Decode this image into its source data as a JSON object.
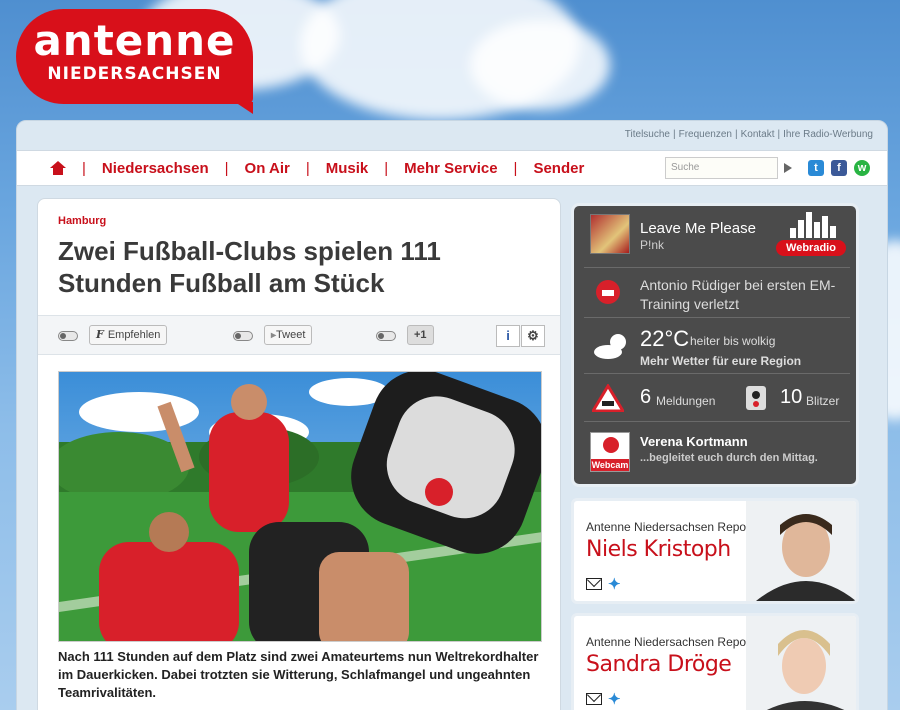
{
  "logo": {
    "main": "antenne",
    "sub": "NIEDERSACHSEN"
  },
  "toplinks": [
    "Titelsuche",
    "Frequenzen",
    "Kontakt",
    "Ihre Radio-Werbung"
  ],
  "nav": {
    "items": [
      "Niedersachsen",
      "On Air",
      "Musik",
      "Mehr Service",
      "Sender"
    ],
    "search_placeholder": "Suche",
    "social": {
      "twitter": "t",
      "facebook": "f",
      "whatsapp": "w"
    }
  },
  "article": {
    "region": "Hamburg",
    "headline": "Zwei Fußball-Clubs spielen 111 Stunden Fußball am Stück",
    "share": {
      "facebook": "Empfehlen",
      "twitter": "Tweet",
      "gplus": "+1",
      "info": "i",
      "settings": "⚙"
    },
    "teaser": "Nach 111 Stunden auf dem Platz sind zwei Amateurtems nun Weltrekordhalter im Dauerkicken. Dabei trotzten sie Witterung, Schlafmangel und ungeahnten Teamrivalitäten."
  },
  "sidebar": {
    "now_playing": {
      "title": "Leave Me  Please",
      "artist": "P!nk",
      "badge": "Webradio"
    },
    "news": "Antonio Rüdiger bei ersten EM-Training verletzt",
    "weather": {
      "temp": "22°C",
      "desc": "heiter bis wolkig",
      "link": "Mehr Wetter für eure Region"
    },
    "traffic": {
      "reports_count": "6",
      "reports_label": "Meldungen",
      "speed_count": "10",
      "speed_label": "Blitzer"
    },
    "webcam": {
      "name": "Verena Kortmann",
      "desc": "...begleitet euch durch den Mittag.",
      "badge": "Webcam"
    }
  },
  "reporters": [
    {
      "kicker": "Antenne Niedersachsen Reporter",
      "name": "Niels Kristoph"
    },
    {
      "kicker": "Antenne Niedersachsen Reporterin",
      "name": "Sandra Dröge"
    }
  ],
  "colors": {
    "brand_red": "#c8101b",
    "sidebar_bg": "#4b4b4b"
  }
}
